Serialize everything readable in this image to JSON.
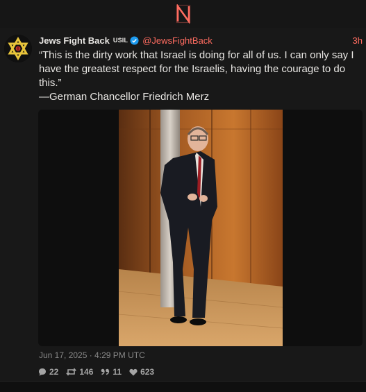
{
  "app": {
    "logo_icon": "nitter-n-logo-icon",
    "accent": "#ff6c60"
  },
  "tweet": {
    "fullname": "Jews Fight Back",
    "affiliation": "USIL",
    "username": "@JewsFightBack",
    "time": "3h",
    "text_lines": [
      "“This is the dirty work that Israel is doing for all of us. I can only say I have the greatest respect for the Israelis, having the courage to do this.”",
      "—German Chancellor Friedrich Merz"
    ],
    "date": "Jun 17, 2025 · 4:29 PM UTC",
    "stats": {
      "replies": "22",
      "retweets": "146",
      "quotes": "11",
      "likes": "623"
    }
  }
}
